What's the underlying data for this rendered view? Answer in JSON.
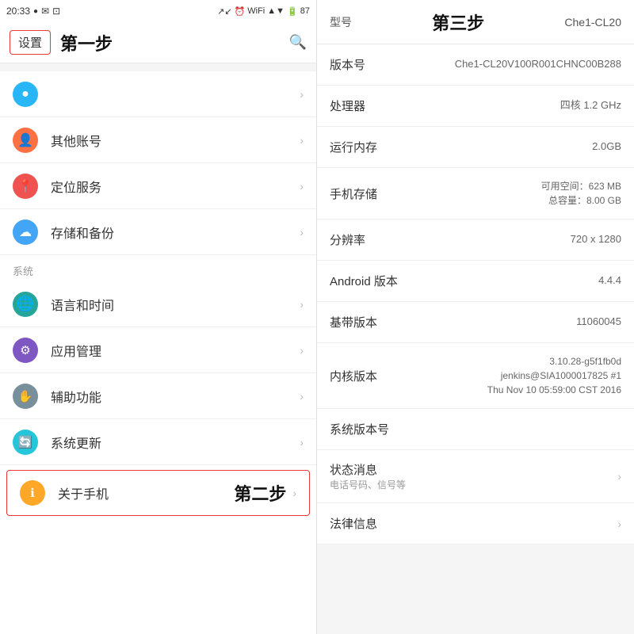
{
  "statusBar": {
    "time": "20:33",
    "battery": "87"
  },
  "leftPanel": {
    "settingsLabel": "设置",
    "step1Label": "第一步",
    "sectionHeader": "系统",
    "menuItems": [
      {
        "id": "account",
        "label": "其他账号",
        "iconClass": "icon-orange",
        "iconSymbol": "👤"
      },
      {
        "id": "location",
        "label": "定位服务",
        "iconClass": "icon-red",
        "iconSymbol": "📍"
      },
      {
        "id": "storage",
        "label": "存储和备份",
        "iconClass": "icon-blue2",
        "iconSymbol": "☁"
      },
      {
        "id": "language",
        "label": "语言和时间",
        "iconClass": "icon-green",
        "iconSymbol": "🌐"
      },
      {
        "id": "apps",
        "label": "应用管理",
        "iconClass": "icon-purple",
        "iconSymbol": "⚙"
      },
      {
        "id": "accessibility",
        "label": "辅助功能",
        "iconClass": "icon-grey",
        "iconSymbol": "✋"
      },
      {
        "id": "update",
        "label": "系统更新",
        "iconClass": "icon-cyan",
        "iconSymbol": "🔄"
      }
    ],
    "aboutItem": {
      "id": "about",
      "label": "关于手机",
      "iconClass": "icon-amber",
      "iconSymbol": "ℹ"
    },
    "step2Label": "第二步"
  },
  "rightPanel": {
    "step3Label": "第三步",
    "modelLabel": "型号",
    "modelValue": "Che1-CL20",
    "rows": [
      {
        "id": "version-num",
        "label": "版本号",
        "value": "Che1-CL20V100R001CHNC00B288",
        "clickable": false
      },
      {
        "id": "processor",
        "label": "处理器",
        "value": "四核 1.2 GHz",
        "clickable": false
      },
      {
        "id": "ram",
        "label": "运行内存",
        "value": "2.0GB",
        "clickable": false
      },
      {
        "id": "storage",
        "label": "手机存储",
        "value": "可用空间：623 MB\n总容量：8.00 GB",
        "clickable": false
      },
      {
        "id": "resolution",
        "label": "分辨率",
        "value": "720 x 1280",
        "clickable": false
      },
      {
        "id": "android",
        "label": "Android 版本",
        "value": "4.4.4",
        "clickable": false
      },
      {
        "id": "baseband",
        "label": "基带版本",
        "value": "11060045",
        "clickable": false
      },
      {
        "id": "kernel",
        "label": "内核版本",
        "value": "3.10.28-g5f1fb0d\njenkins@SIA1000017825 #1\nThu Nov 10 05:59:00 CST 2016",
        "clickable": false
      },
      {
        "id": "system-version",
        "label": "系统版本号",
        "value": "",
        "clickable": false
      },
      {
        "id": "status",
        "label": "状态消息",
        "sub": "电话号码、信号等",
        "value": "",
        "clickable": true
      },
      {
        "id": "legal",
        "label": "法律信息",
        "value": "",
        "clickable": true
      }
    ]
  }
}
